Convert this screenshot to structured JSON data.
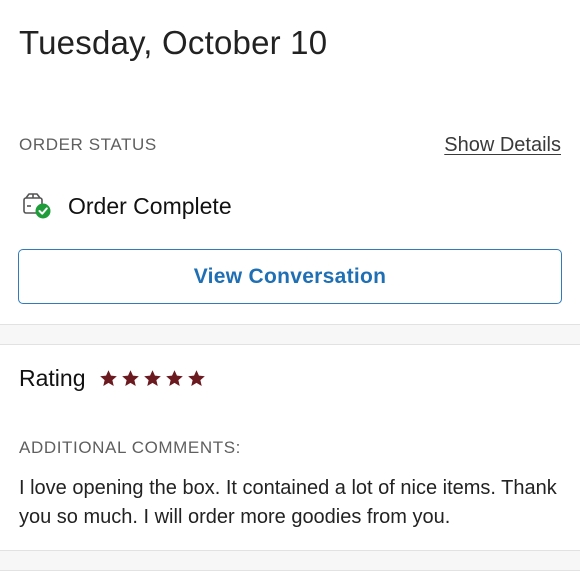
{
  "header": {
    "date": "Tuesday, October 10"
  },
  "order_status": {
    "section_label": "ORDER STATUS",
    "show_details_label": "Show Details",
    "status_text": "Order Complete",
    "status_icon": "box-check-icon",
    "check_color": "#1f9d3a"
  },
  "actions": {
    "view_conversation_label": "View Conversation",
    "accent_color": "#1f6fb5"
  },
  "rating": {
    "label": "Rating",
    "stars": 5,
    "max_stars": 5,
    "star_color": "#6b1a20"
  },
  "comments": {
    "section_label": "ADDITIONAL COMMENTS:",
    "text": "I love opening the box. It contained a lot of nice items. Thank you so much. I will order more goodies from you."
  }
}
